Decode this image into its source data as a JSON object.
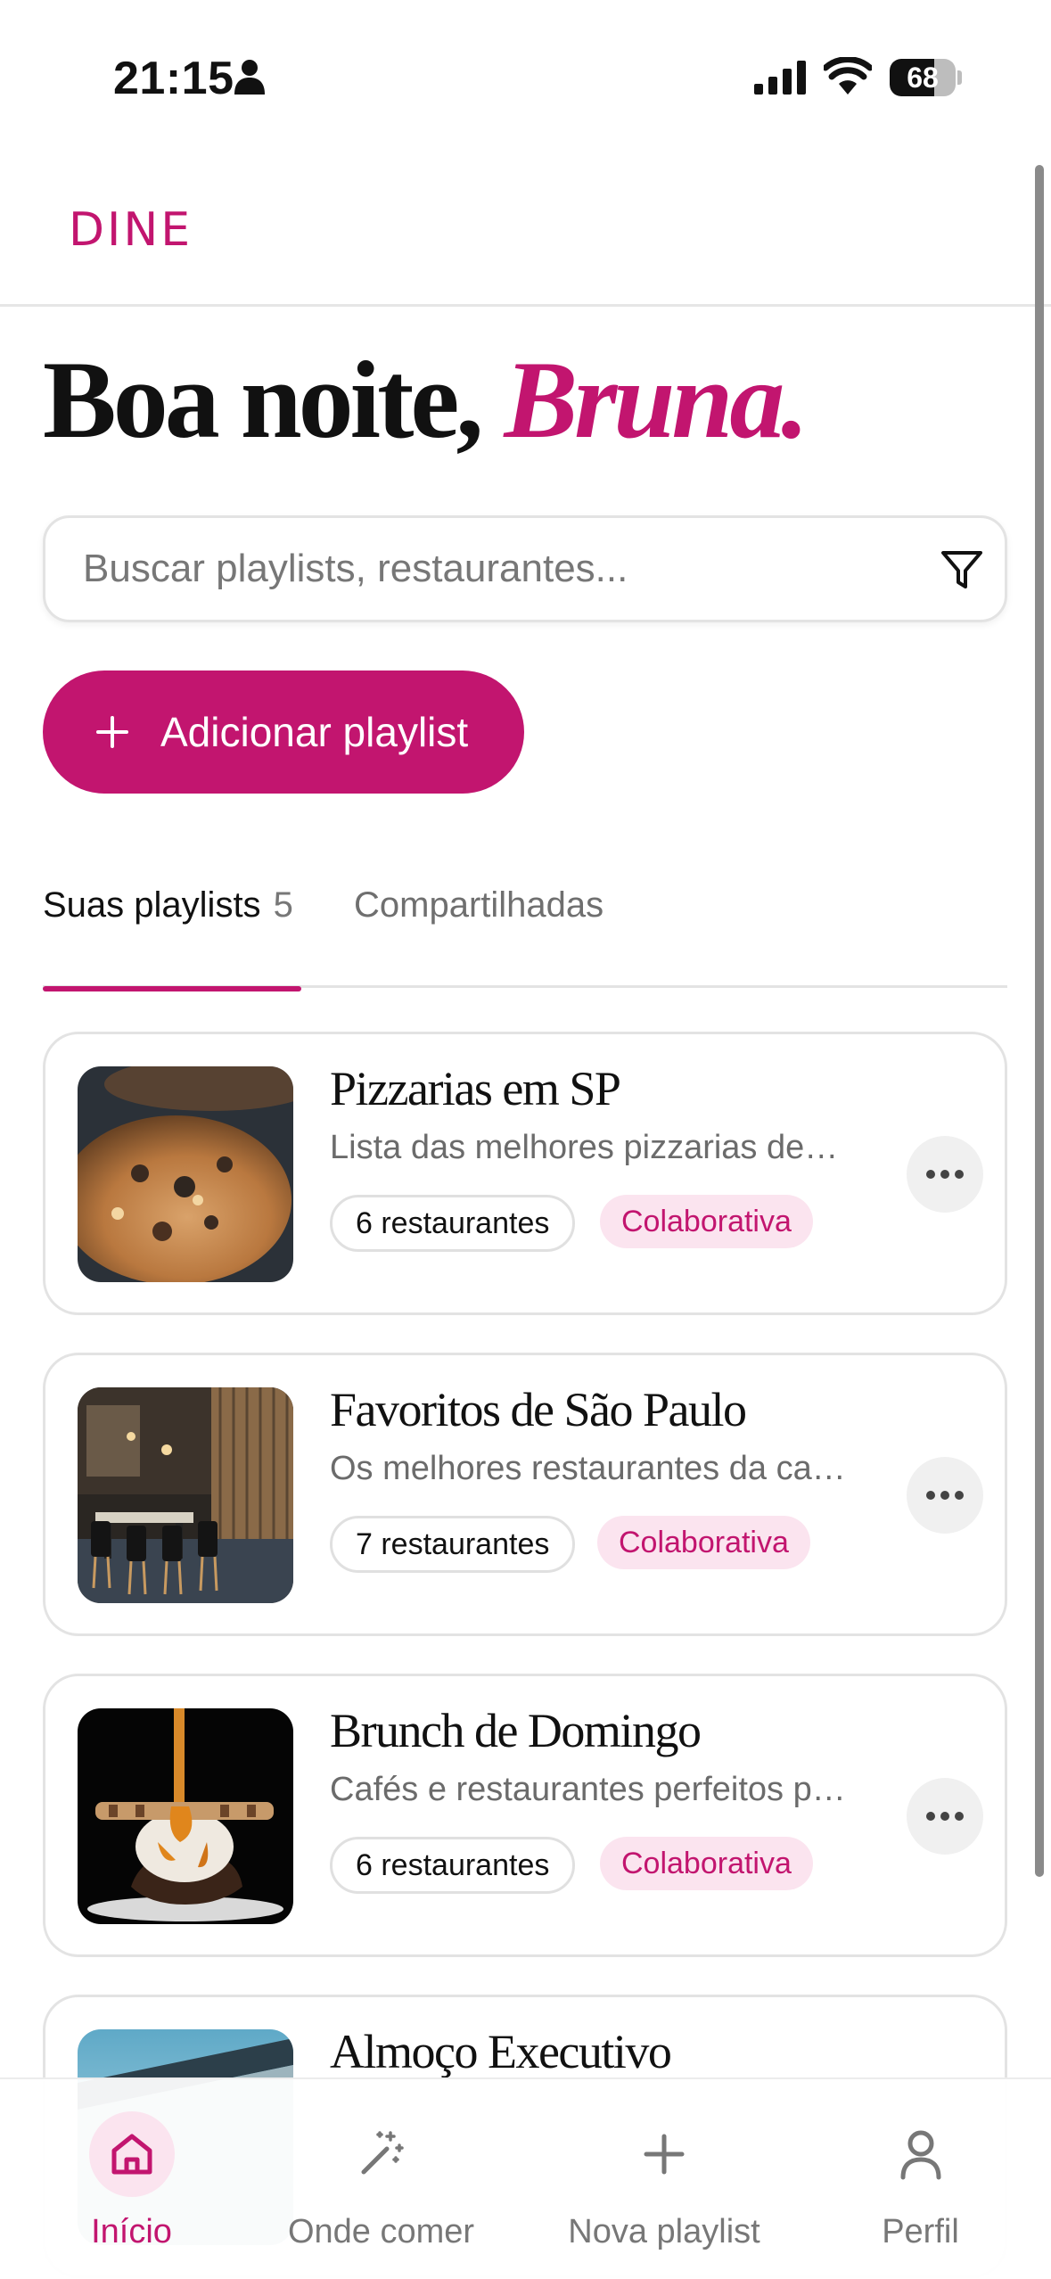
{
  "status_bar": {
    "time": "21:15",
    "battery": "68",
    "battery_level": 0.68
  },
  "header": {
    "logo": "DINE"
  },
  "greeting": {
    "prefix": "Boa noite, ",
    "name": "Bruna."
  },
  "search": {
    "placeholder": "Buscar playlists, restaurantes..."
  },
  "add_button": {
    "label": "Adicionar playlist"
  },
  "tabs": [
    {
      "label": "Suas playlists",
      "count": "5"
    },
    {
      "label": "Compartilhadas"
    }
  ],
  "playlists": [
    {
      "title": "Pizzarias em SP",
      "description": "Lista das melhores pizzarias de são paulo",
      "count": "6 restaurantes",
      "tag": "Colaborativa",
      "image": "pizza"
    },
    {
      "title": "Favoritos de São Paulo",
      "description": "Os melhores restaurantes da capital paulista",
      "count": "7 restaurantes",
      "tag": "Colaborativa",
      "image": "restaurant-interior"
    },
    {
      "title": "Brunch de Domingo",
      "description": "Cafés e restaurantes perfeitos para o domingo",
      "count": "6 restaurantes",
      "tag": "Colaborativa",
      "image": "dessert"
    },
    {
      "title": "Almoço Executivo",
      "image": "building"
    }
  ],
  "bottom_nav": [
    {
      "label": "Início",
      "icon": "home-icon",
      "active": true
    },
    {
      "label": "Onde comer",
      "icon": "magic-wand-icon"
    },
    {
      "label": "Nova playlist",
      "icon": "plus-icon"
    },
    {
      "label": "Perfil",
      "icon": "user-icon"
    }
  ],
  "colors": {
    "accent": "#c2156f",
    "accent_soft": "#fbe4ef"
  }
}
